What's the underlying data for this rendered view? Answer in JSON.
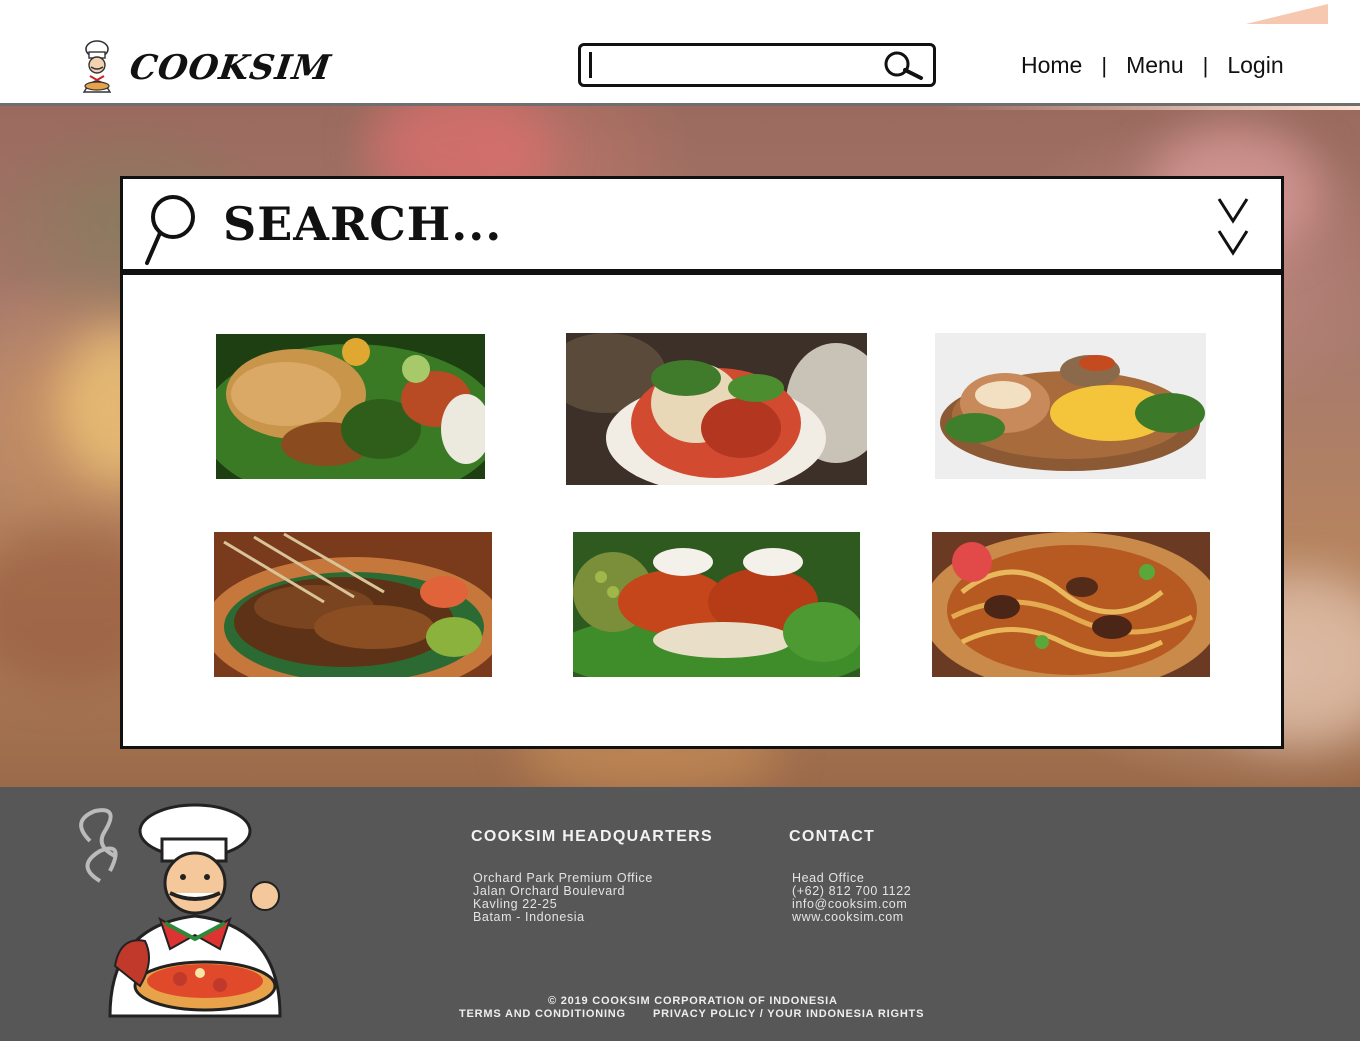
{
  "header": {
    "brand": "COOKSIM",
    "search": {
      "value": "",
      "placeholder": ""
    },
    "nav": [
      {
        "label": "Home"
      },
      {
        "label": "Menu"
      },
      {
        "label": "Login"
      }
    ],
    "nav_separator": "|"
  },
  "panel": {
    "title": "SEARCH...",
    "expand_icon": "double-chevron-down-icon",
    "results": [
      {
        "name": "nasi-ayam-serundeng",
        "colors": [
          "#2f6b1f",
          "#c58a3c",
          "#b23a1f"
        ]
      },
      {
        "name": "kimchi-plate",
        "colors": [
          "#e9e2d4",
          "#c8412a",
          "#3c6d25"
        ]
      },
      {
        "name": "sausage-fries-platter",
        "colors": [
          "#eeeeee",
          "#f5c542",
          "#8a5a36"
        ]
      },
      {
        "name": "sate-plate",
        "colors": [
          "#6b3a1e",
          "#a8652c",
          "#2d7a3a"
        ]
      },
      {
        "name": "crepe-rolls-plate",
        "colors": [
          "#b33a15",
          "#f3efe6",
          "#3e8c2a"
        ]
      },
      {
        "name": "mie-goreng-plate",
        "colors": [
          "#b85e24",
          "#e8b45a",
          "#4b2a18"
        ]
      }
    ]
  },
  "footer": {
    "hq_title": "COOKSIM HEADQUARTERS",
    "hq_lines": [
      "Orchard Park Premium Office",
      "Jalan Orchard Boulevard",
      "Kavling 22-25",
      "Batam - Indonesia"
    ],
    "contact_title": "CONTACT",
    "contact_lines": [
      "Head Office",
      "(+62) 812 700 1122",
      "info@cooksim.com",
      "www.cooksim.com"
    ],
    "copyright": "© 2019 COOKSIM CORPORATION OF INDONESIA",
    "terms": "TERMS AND CONDITIONING",
    "privacy": "PRIVACY POLICY / YOUR INDONESIA RIGHTS"
  }
}
